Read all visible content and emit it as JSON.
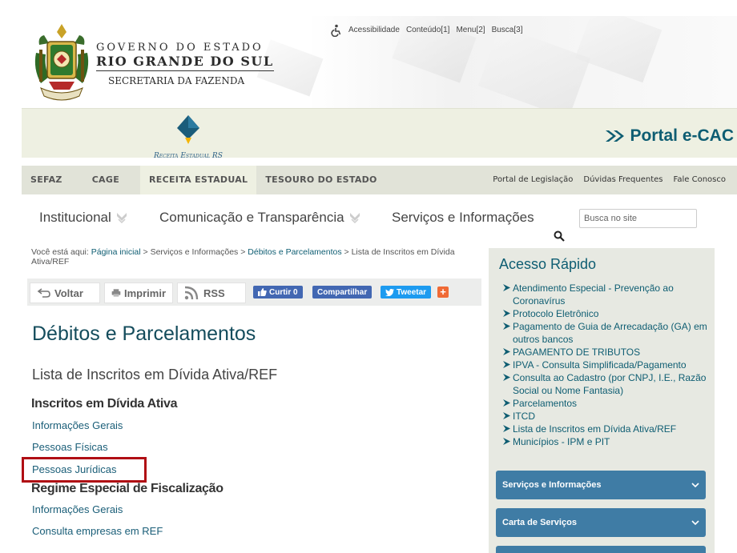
{
  "header": {
    "gov_line1": "GOVERNO DO ESTADO",
    "gov_line2": "RIO GRANDE DO SUL",
    "gov_line3": "SECRETARIA DA FAZENDA",
    "access_links": [
      "Acessibilidade",
      "Conteúdo[1]",
      "Menu[2]",
      "Busca[3]"
    ]
  },
  "banner": {
    "receita_label": "Receita Estadual RS",
    "portal_label": "Portal e-CAC",
    "accent": "#0e5d72"
  },
  "topnav": {
    "left": [
      "SEFAZ",
      "CAGE",
      "RECEITA ESTADUAL",
      "TESOURO DO ESTADO"
    ],
    "right": [
      "Portal de Legislação",
      "Dúvidas Frequentes",
      "Fale Conosco"
    ]
  },
  "mainnav": {
    "items": [
      "Institucional",
      "Comunicação e Transparência",
      "Serviços e Informações"
    ],
    "search_placeholder": "Busca no site"
  },
  "breadcrumb": {
    "prefix": "Você está aqui:",
    "home": "Página inicial",
    "sep1": ">",
    "crumb2": "Serviços e Informações",
    "sep2": ">",
    "crumb3": "Débitos e Parcelamentos",
    "sep3": ">",
    "crumb4": "Lista de Inscritos em Dívida Ativa/REF"
  },
  "toolbar": {
    "back": "Voltar",
    "print": "Imprimir",
    "rss": "RSS",
    "like": "Curtir 0",
    "share": "Compartilhar",
    "tweet": "Tweetar",
    "plus": "+"
  },
  "content": {
    "title": "Débitos e Parcelamentos",
    "subtitle": "Lista de Inscritos em Dívida Ativa/REF",
    "section1": "Inscritos em Dívida Ativa",
    "section1_links": [
      "Informações Gerais",
      "Pessoas Físicas",
      "Pessoas Jurídicas"
    ],
    "section2": "Regime Especial de Fiscalização",
    "section2_links": [
      "Informações Gerais",
      "Consulta empresas em REF"
    ]
  },
  "sidebar": {
    "title": "Acesso Rápido",
    "quick_links": [
      "Atendimento Especial - Prevenção ao Coronavírus",
      "Protocolo Eletrônico",
      "Pagamento de Guia de Arrecadação (GA) em outros bancos",
      "PAGAMENTO DE TRIBUTOS",
      "IPVA - Consulta Simplificada/Pagamento",
      "Consulta ao Cadastro (por CNPJ, I.E., Razão Social ou Nome Fantasia)",
      "Parcelamentos",
      "ITCD",
      "Lista de Inscritos em Dívida Ativa/REF",
      "Municípios - IPM e PIT"
    ],
    "panels": [
      "Serviços e Informações",
      "Carta de Serviços"
    ]
  }
}
